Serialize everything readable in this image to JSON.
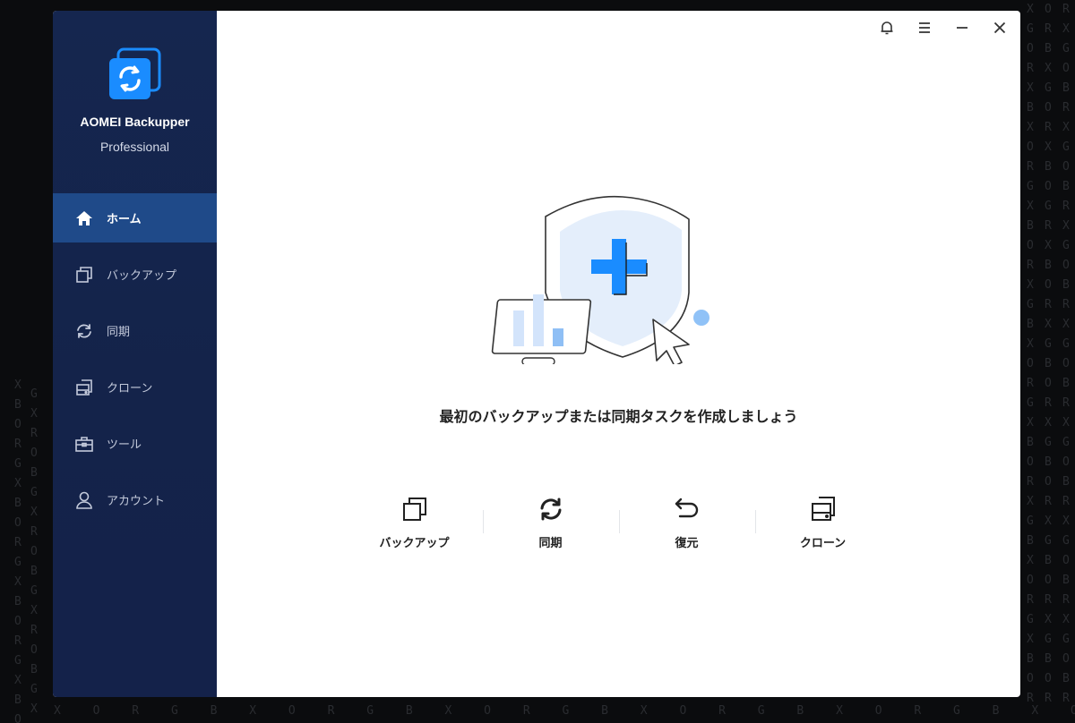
{
  "app": {
    "name": "AOMEI Backupper",
    "edition": "Professional"
  },
  "sidebar": {
    "items": [
      {
        "label": "ホーム",
        "icon": "home-icon",
        "active": true
      },
      {
        "label": "バックアップ",
        "icon": "backup-icon",
        "active": false
      },
      {
        "label": "同期",
        "icon": "sync-icon",
        "active": false
      },
      {
        "label": "クローン",
        "icon": "clone-icon",
        "active": false
      },
      {
        "label": "ツール",
        "icon": "toolbox-icon",
        "active": false
      },
      {
        "label": "アカウント",
        "icon": "account-icon",
        "active": false
      }
    ]
  },
  "titlebar": {
    "icons": [
      "bell-icon",
      "menu-icon",
      "minimize-icon",
      "close-icon"
    ]
  },
  "main": {
    "headline": "最初のバックアップまたは同期タスクを作成しましょう",
    "actions": [
      {
        "label": "バックアップ",
        "icon": "backup-icon"
      },
      {
        "label": "同期",
        "icon": "sync-icon"
      },
      {
        "label": "復元",
        "icon": "restore-icon"
      },
      {
        "label": "クローン",
        "icon": "clone-icon"
      }
    ]
  },
  "colors": {
    "sidebar_bg": "#15264f",
    "sidebar_active": "#1f4a89",
    "accent": "#1a8cff",
    "text": "#222222"
  }
}
